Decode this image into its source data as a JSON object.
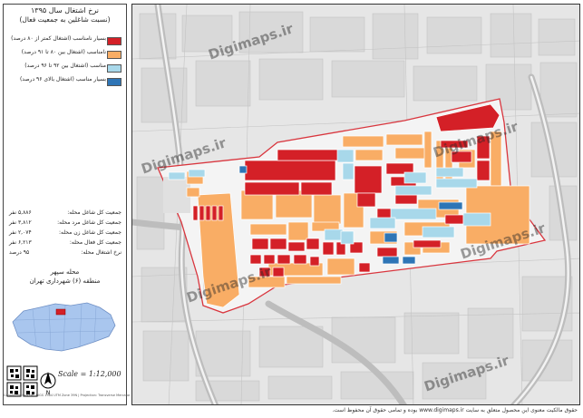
{
  "legend": {
    "title_line1": "نرخ اشتغال سال ۱۳۹۵",
    "title_line2": "(نسبت شاغلین به جمعیت فعال)",
    "items": [
      {
        "label": "بسیار نامناسب (اشتغال کمتر از ۸۰ درصد)",
        "color": "#d42027"
      },
      {
        "label": "نامناسب (اشتغال بین ۸۰ تا ۹۱ درصد)",
        "color": "#f9ad65"
      },
      {
        "label": "مناسب (اشتغال بین ۹۲ تا ۹۶ درصد)",
        "color": "#a8d8ea"
      },
      {
        "label": "بسیار مناسب (اشتغال بالای ۹۶ درصد)",
        "color": "#2e75b6"
      }
    ]
  },
  "stats": [
    {
      "key": "جمعیت کل شاغل محله:",
      "value": "۵,۸۸۶ نفر"
    },
    {
      "key": "جمعیت کل شاغل مرد محله:",
      "value": "۳,۸۱۲ نفر"
    },
    {
      "key": "جمعیت کل شاغل زن محله:",
      "value": "۲,۰۷۴ نفر"
    },
    {
      "key": "جمعیت کل فعال محله:",
      "value": "۶,۲۱۳ نفر"
    },
    {
      "key": "نرخ اشتغال محله:",
      "value": "۹۵ درصد"
    }
  ],
  "area": {
    "neighborhood": "محله سپهر",
    "district": "منطقه (۶) شهرداری تهران"
  },
  "scale": "Scale = 1:12,000",
  "north_label": "N",
  "credit": "Coordinate System: WGS 1984 UTM Zone 39N  |  Projection: Transverse Mercator",
  "watermark": "Digimaps.ir",
  "bottom_note": "حقوق مالکیت معنوی این محصول متعلق به سایت www.digimaps.ir بوده و تمامی حقوق آن محفوظ است."
}
